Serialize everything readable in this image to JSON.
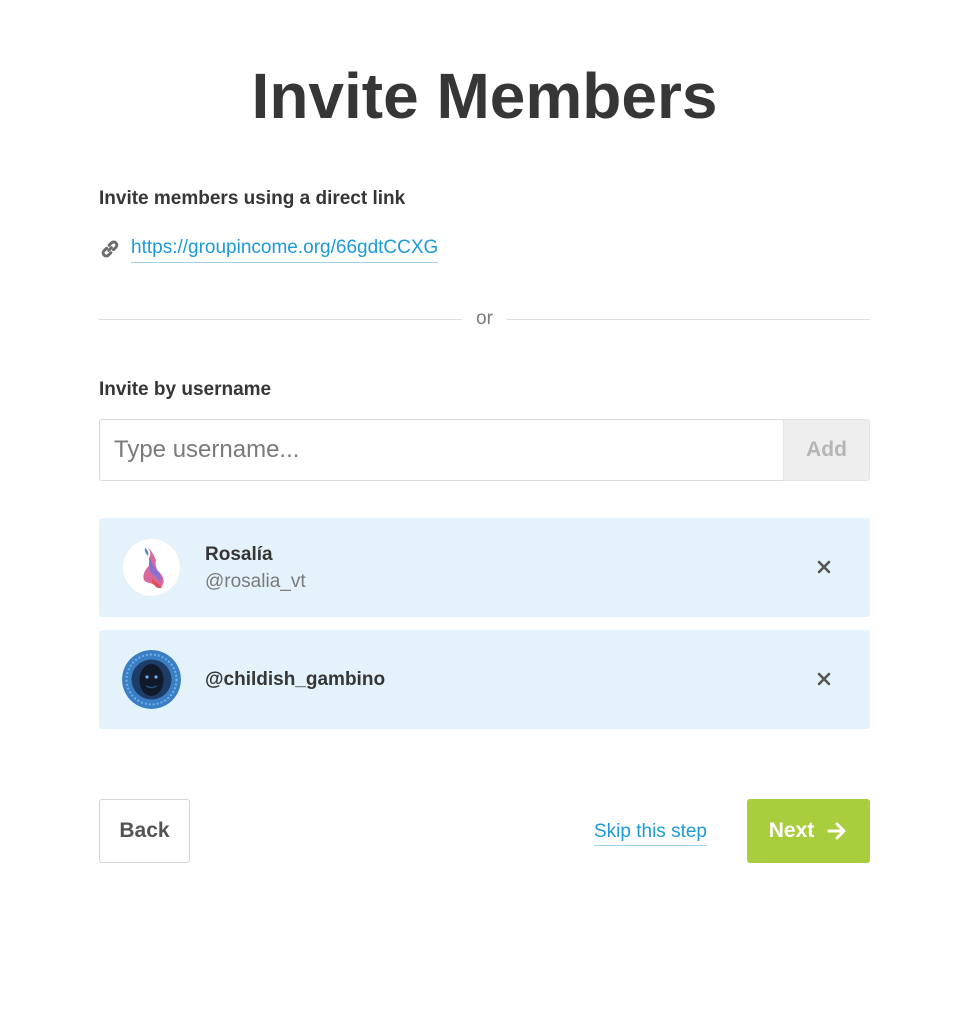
{
  "page": {
    "title": "Invite Members"
  },
  "direct_link": {
    "label": "Invite members using a direct link",
    "url": "https://groupincome.org/66gdtCCXG",
    "icon": "link-icon"
  },
  "divider": {
    "text": "or"
  },
  "username_invite": {
    "label": "Invite by username",
    "placeholder": "Type username...",
    "value": "",
    "add_label": "Add"
  },
  "members": [
    {
      "name": "Rosalía",
      "handle": "@rosalia_vt",
      "avatar": "avatar-rosalia"
    },
    {
      "name": "@childish_gambino",
      "handle": "",
      "avatar": "avatar-childish-gambino"
    }
  ],
  "footer": {
    "back_label": "Back",
    "skip_label": "Skip this step",
    "next_label": "Next",
    "next_icon": "arrow-right-icon"
  },
  "colors": {
    "link": "#1c9bd6",
    "member_card_bg": "#e3f2fb",
    "next_button_bg": "#a8cd3d",
    "text_dark": "#363636",
    "text_muted": "#7a7a7a"
  }
}
